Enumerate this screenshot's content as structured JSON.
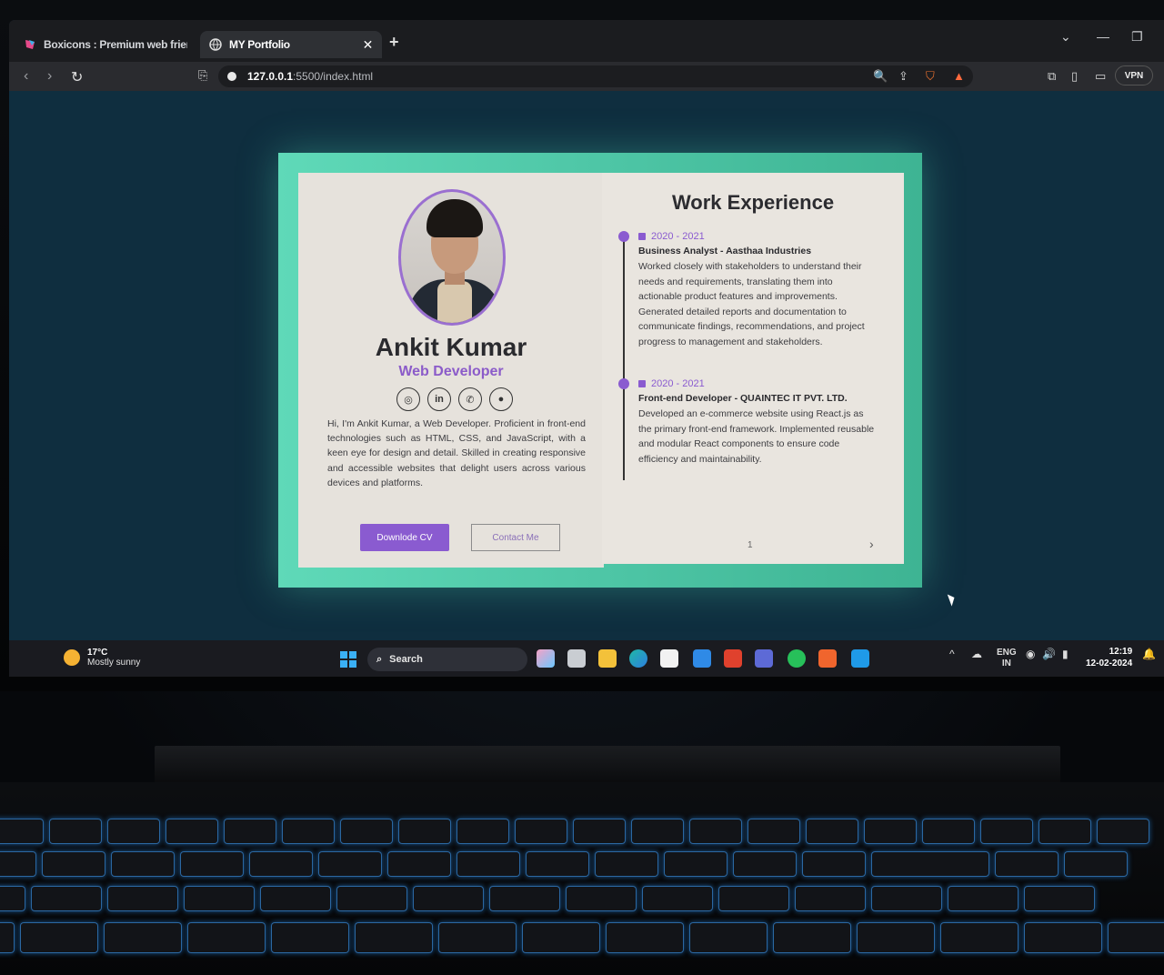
{
  "browser": {
    "tabs": [
      {
        "label": "Boxicons : Premium web friendly ico",
        "active": false
      },
      {
        "label": "MY Portfolio",
        "active": true
      }
    ],
    "url_host": "127.0.0.1",
    "url_path": ":5500/index.html",
    "vpn_label": "VPN"
  },
  "portfolio": {
    "name": "Ankit Kumar",
    "role": "Web Developer",
    "socials": [
      "instagram-icon",
      "linkedin-icon",
      "whatsapp-icon",
      "github-icon"
    ],
    "bio": "Hi, I'm Ankit Kumar, a Web Developer. Proficient in front-end technologies such as HTML, CSS, and JavaScript, with a keen eye for design and detail. Skilled in creating responsive and accessible websites that delight users across various devices and platforms.",
    "download_btn": "Downlode CV",
    "contact_btn": "Contact Me",
    "work_title": "Work Experience",
    "experiences": [
      {
        "date": "2020 - 2021",
        "role": "Business Analyst - Aasthaa Industries",
        "desc": "Worked closely with stakeholders to understand their needs and requirements, translating them into actionable product features and improvements. Generated detailed reports and documentation to communicate findings, recommendations, and project progress to management and stakeholders."
      },
      {
        "date": "2020 - 2021",
        "role": "Front-end Developer - QUAINTEC IT PVT. LTD.",
        "desc": "Developed an e-commerce website using React.js as the primary front-end framework. Implemented reusable and modular React components to ensure code efficiency and maintainability."
      }
    ],
    "page_number": "1",
    "next_arrow": "›"
  },
  "taskbar": {
    "weather_temp": "17°C",
    "weather_cond": "Mostly sunny",
    "search_label": "Search",
    "lang_top": "ENG",
    "lang_bottom": "IN",
    "time": "12:19",
    "date": "12-02-2024"
  },
  "colors": {
    "accent_purple": "#8a5bd0",
    "book_frame_teal": "#4ec6a6",
    "page_bg": "#0f2e3f"
  }
}
